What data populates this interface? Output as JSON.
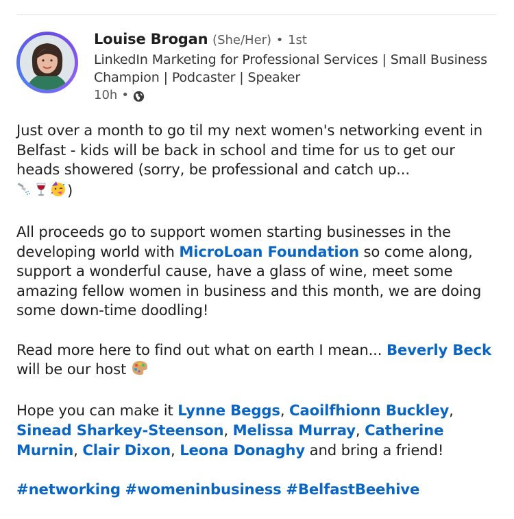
{
  "post": {
    "author": {
      "name": "Louise Brogan",
      "pronouns": "(She/Her)",
      "separator": "•",
      "degree": "1st",
      "headline": "LinkedIn Marketing for Professional Services | Small Business Champion | Podcaster | Speaker",
      "time": "10h",
      "time_separator": "•",
      "visibility_icon": "globe-icon"
    },
    "body": {
      "p1_text": "Just over a month to go til my next women's networking event in Belfast - kids will be back in school and time for us to get our heads showered (sorry, be professional and catch up...",
      "p1_end": ")",
      "p2_before": "All proceeds go to support women starting businesses in the developing world with ",
      "p2_mention": "MicroLoan Foundation",
      "p2_after": " so come along, support a wonderful cause, have a glass of wine,  meet some amazing fellow women in business and this month, we are doing some down-time doodling!",
      "p3_before": "Read more here to find out what on earth I mean... ",
      "p3_mention": "Beverly Beck",
      "p3_after": " will be our host",
      "p4_before": "Hope you can make it ",
      "p4_mentions": [
        "Lynne Beggs",
        "Caoilfhionn Buckley",
        "Sinead Sharkey-Steenson",
        "Melissa Murray",
        "Catherine Murnin",
        "Clair Dixon",
        "Leona Donaghy"
      ],
      "p4_sep": ", ",
      "p4_after": " and bring a friend!",
      "hashtags": [
        "#networking",
        "#womeninbusiness",
        "#BelfastBeehive"
      ]
    },
    "emojis": [
      "shower-icon",
      "wine-glass-icon",
      "partying-face-icon",
      "artist-palette-icon"
    ],
    "colors": {
      "link": "#0a66c2",
      "text": "#1f1f1f",
      "muted": "#5a5a5a"
    }
  }
}
